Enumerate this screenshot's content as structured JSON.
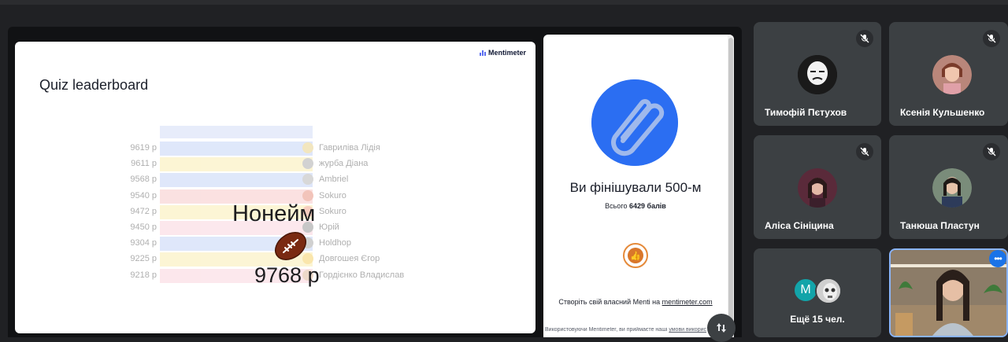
{
  "slide": {
    "brand": "Mentimeter",
    "title": "Quiz leaderboard",
    "winner": {
      "name": "Нонейм",
      "score": "9768 p"
    },
    "leaderboard": [
      {
        "score": "9619 p",
        "name": "Гавриліва Лідія",
        "color": "#9db8f0",
        "avatar": "#d8b23a"
      },
      {
        "score": "9611 p",
        "name": "журба Діана",
        "color": "#f7e17c",
        "avatar": "#777777"
      },
      {
        "score": "9568 p",
        "name": "Ambriel",
        "color": "#9db8f0",
        "avatar": "#888888"
      },
      {
        "score": "9540 p",
        "name": "Sokuro",
        "color": "#f2a3a3",
        "avatar": "#d94a2b"
      },
      {
        "score": "9472 p",
        "name": "Sokuro",
        "color": "#f7e17c",
        "avatar": "#e5663a"
      },
      {
        "score": "9450 p",
        "name": "Юрій",
        "color": "#f6b8c6",
        "avatar": "#555555"
      },
      {
        "score": "9304 p",
        "name": "Holdhop",
        "color": "#9db8f0",
        "avatar": "#6f6f6f"
      },
      {
        "score": "9225 p",
        "name": "Довгошея Єгор",
        "color": "#f7e17c",
        "avatar": "#f0b400"
      },
      {
        "score": "9218 p",
        "name": "Гордієнко Владислав",
        "color": "#f6b8c6",
        "avatar": "#c98a5a"
      }
    ]
  },
  "side_card": {
    "finish": "Ви фінішували 500-м",
    "points_prefix": "Всього",
    "points_value": "6429 балів",
    "create_text": "Створіть свій власний Menti на",
    "create_link": "mentimeter.com",
    "terms_text": "Використовуючи Mentimeter, ви приймаєте наші",
    "terms_link": "умови викорис"
  },
  "participants": [
    {
      "name": "Тимофій Пєтухов",
      "muted": true
    },
    {
      "name": "Ксенія Кульшенко",
      "muted": true
    },
    {
      "name": "Аліса Сініцина",
      "muted": true
    },
    {
      "name": "Танюша Пластун",
      "muted": true
    }
  ],
  "more": {
    "initial": "M",
    "label": "Ещё 15 чел."
  },
  "colors": {
    "accent": "#1a73e8",
    "menti_blue": "#2b6ef2",
    "tile": "#3c4043"
  }
}
